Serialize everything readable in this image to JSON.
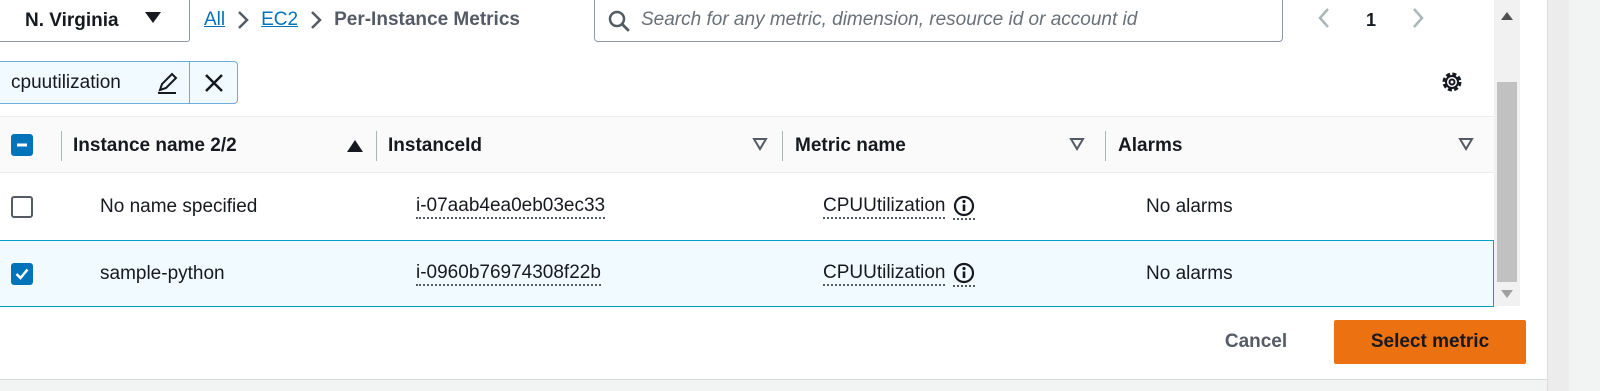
{
  "header": {
    "region": "N. Virginia",
    "breadcrumbs": [
      "All",
      "EC2",
      "Per-Instance Metrics"
    ],
    "search": {
      "value": "",
      "placeholder": "Search for any metric, dimension, resource id or account id"
    },
    "pager": {
      "page": "1"
    }
  },
  "filter": {
    "token": "cpuutilization"
  },
  "table": {
    "columns": {
      "instance_name": "Instance name 2/2",
      "instance_id": "InstanceId",
      "metric_name": "Metric name",
      "alarms": "Alarms"
    },
    "rows": [
      {
        "name": "No name specified",
        "id": "i-07aab4ea0eb03ec33",
        "metric": "CPUUtilization",
        "alarms": "No alarms",
        "selected": false
      },
      {
        "name": "sample-python",
        "id": "i-0960b76974308f22b",
        "metric": "CPUUtilization",
        "alarms": "No alarms",
        "selected": true
      }
    ]
  },
  "footer": {
    "cancel": "Cancel",
    "select": "Select metric"
  },
  "colors": {
    "accent": "#ec7211",
    "link": "#0073bb",
    "selected_bg": "#f1faff"
  },
  "icons": [
    "caret-down-icon",
    "chevron-right-icon",
    "search-icon",
    "chevron-left-icon",
    "edit-icon",
    "close-icon",
    "gear-icon",
    "sort-asc-icon",
    "sort-desc-icon",
    "info-icon",
    "checkbox-icon"
  ]
}
